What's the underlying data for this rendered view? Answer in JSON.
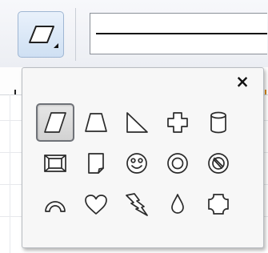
{
  "toolbar": {
    "shape_button": {
      "icon": "parallelogram-icon",
      "has_dropdown": true
    },
    "line_style": {
      "selected_style": "solid"
    }
  },
  "shape_panel": {
    "close_label": "×",
    "selected_shape": "parallelogram",
    "shapes": [
      [
        "parallelogram",
        "trapezoid",
        "right-triangle",
        "plus",
        "can"
      ],
      [
        "bevel",
        "folded-corner",
        "smiley-face",
        "donut",
        "no-symbol"
      ],
      [
        "block-arc",
        "heart",
        "lightning-bolt",
        "moon",
        "plaque"
      ]
    ]
  },
  "colors": {
    "selection_border": "#6f7278",
    "panel_background": "#f7f7f7",
    "button_highlight": "#cfe0f3"
  }
}
